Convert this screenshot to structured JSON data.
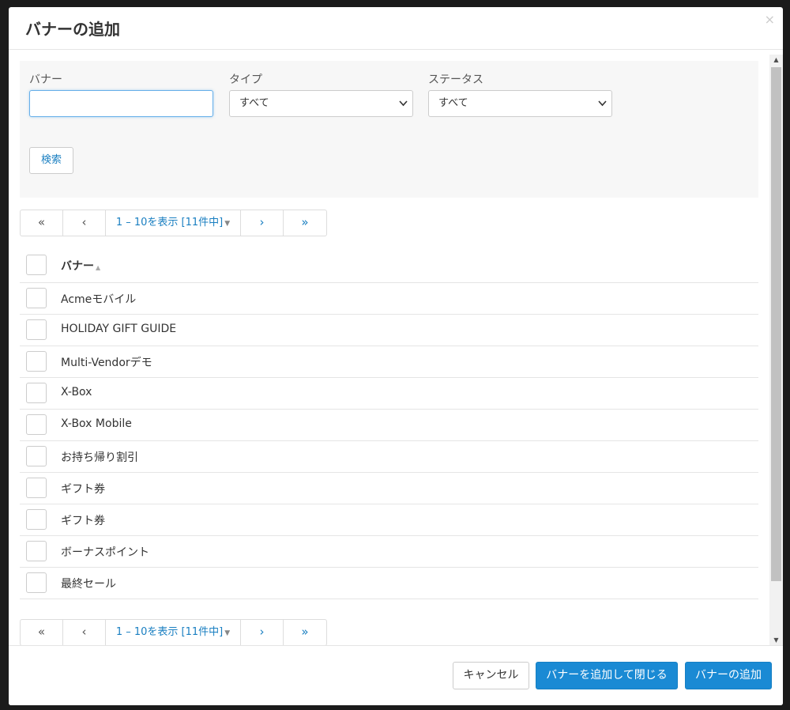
{
  "dialog": {
    "title": "バナーの追加",
    "close_glyph": "×"
  },
  "search": {
    "banner_label": "バナー",
    "banner_value": "",
    "type_label": "タイプ",
    "type_selected": "すべて",
    "status_label": "ステータス",
    "status_selected": "すべて",
    "search_button": "検索"
  },
  "pagination": {
    "first": "«",
    "prev": "‹",
    "info": "1 – 10を表示 [11件中]",
    "next": "›",
    "last": "»"
  },
  "table": {
    "column_header": "バナー",
    "rows": [
      "Acmeモバイル",
      "HOLIDAY GIFT GUIDE",
      "Multi-Vendorデモ",
      "X-Box",
      "X-Box Mobile",
      "お持ち帰り割引",
      "ギフト券",
      "ギフト券",
      "ボーナスポイント",
      "最終セール"
    ]
  },
  "footer": {
    "cancel": "キャンセル",
    "add_and_close": "バナーを追加して閉じる",
    "add": "バナーの追加"
  },
  "colors": {
    "primary": "#1a8ad4",
    "link": "#1a7fc1",
    "panel_bg": "#f7f7f7"
  }
}
